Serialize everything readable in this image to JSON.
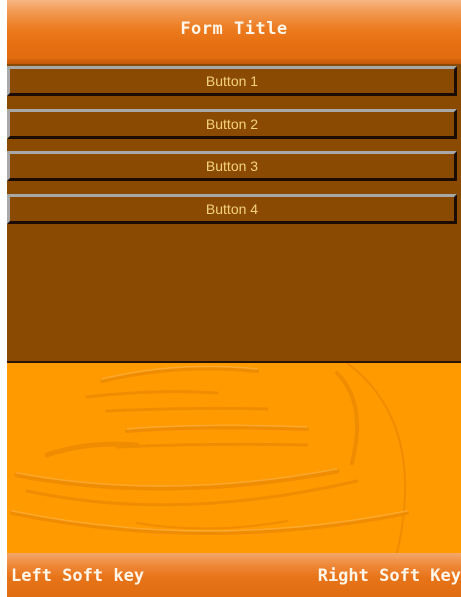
{
  "form": {
    "title": "Form Title"
  },
  "buttons": [
    {
      "label": "Button 1"
    },
    {
      "label": "Button 2"
    },
    {
      "label": "Button 3"
    },
    {
      "label": "Button 4"
    }
  ],
  "soft_keys": {
    "left": "Left Soft key",
    "right": "Right Soft Key"
  },
  "colors": {
    "title_bar": "#ec7b1f",
    "content_background": "#8b4a02",
    "button_text": "#f3d27a",
    "background_art": "#ff9a00",
    "soft_bar": "#e8741a"
  }
}
